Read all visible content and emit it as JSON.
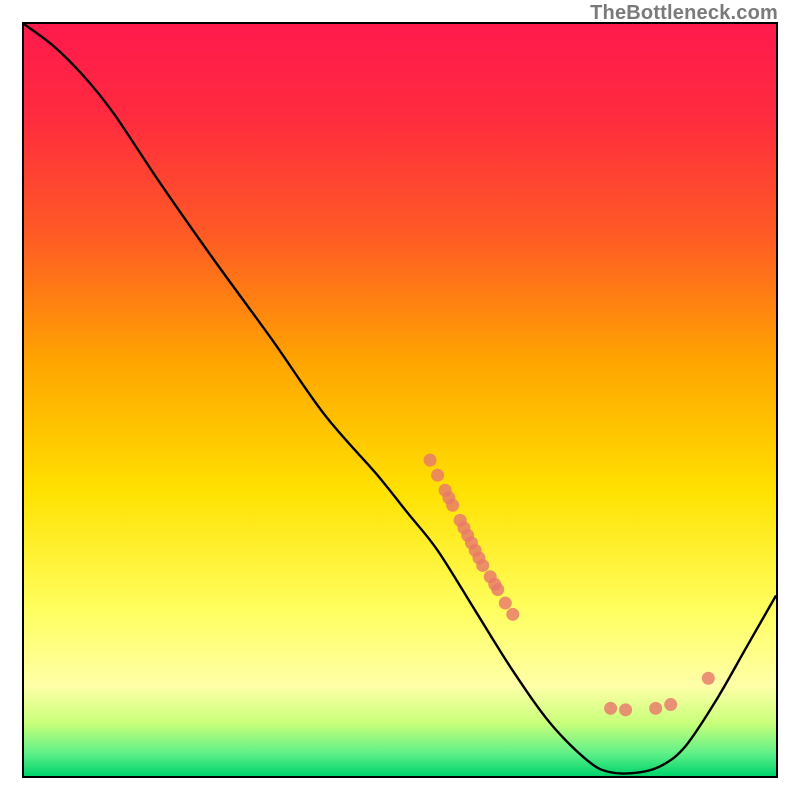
{
  "watermark": "TheBottleneck.com",
  "chart_data": {
    "type": "line",
    "title": "",
    "xlabel": "",
    "ylabel": "",
    "xlim": [
      0,
      100
    ],
    "ylim": [
      0,
      100
    ],
    "grid": false,
    "gradient_colors": [
      "#ff1a4d",
      "#ff3c3c",
      "#ff8a00",
      "#ffd500",
      "#ffff4d",
      "#99ff66",
      "#2fe07a",
      "#00d46c"
    ],
    "curve": [
      {
        "x": 0,
        "y": 100
      },
      {
        "x": 4,
        "y": 97
      },
      {
        "x": 8,
        "y": 93
      },
      {
        "x": 12,
        "y": 88
      },
      {
        "x": 18,
        "y": 79
      },
      {
        "x": 25,
        "y": 69
      },
      {
        "x": 33,
        "y": 58
      },
      {
        "x": 40,
        "y": 48
      },
      {
        "x": 47,
        "y": 40
      },
      {
        "x": 51,
        "y": 35
      },
      {
        "x": 55,
        "y": 30
      },
      {
        "x": 60,
        "y": 22
      },
      {
        "x": 65,
        "y": 14
      },
      {
        "x": 70,
        "y": 7
      },
      {
        "x": 75,
        "y": 2
      },
      {
        "x": 78,
        "y": 0.5
      },
      {
        "x": 82,
        "y": 0.5
      },
      {
        "x": 85,
        "y": 1.5
      },
      {
        "x": 88,
        "y": 4
      },
      {
        "x": 92,
        "y": 10
      },
      {
        "x": 96,
        "y": 17
      },
      {
        "x": 100,
        "y": 24
      }
    ],
    "scatter_points": [
      {
        "x": 54,
        "y": 42
      },
      {
        "x": 55,
        "y": 40
      },
      {
        "x": 56,
        "y": 38
      },
      {
        "x": 56.5,
        "y": 37
      },
      {
        "x": 57,
        "y": 36
      },
      {
        "x": 58,
        "y": 34
      },
      {
        "x": 58.5,
        "y": 33
      },
      {
        "x": 59,
        "y": 32
      },
      {
        "x": 59.5,
        "y": 31
      },
      {
        "x": 60,
        "y": 30
      },
      {
        "x": 60.5,
        "y": 29
      },
      {
        "x": 61,
        "y": 28
      },
      {
        "x": 62,
        "y": 26.5
      },
      {
        "x": 62.6,
        "y": 25.5
      },
      {
        "x": 63,
        "y": 24.8
      },
      {
        "x": 64,
        "y": 23
      },
      {
        "x": 65,
        "y": 21.5
      },
      {
        "x": 78,
        "y": 9
      },
      {
        "x": 80,
        "y": 8.8
      },
      {
        "x": 84,
        "y": 9
      },
      {
        "x": 86,
        "y": 9.5
      },
      {
        "x": 91,
        "y": 13
      }
    ]
  }
}
